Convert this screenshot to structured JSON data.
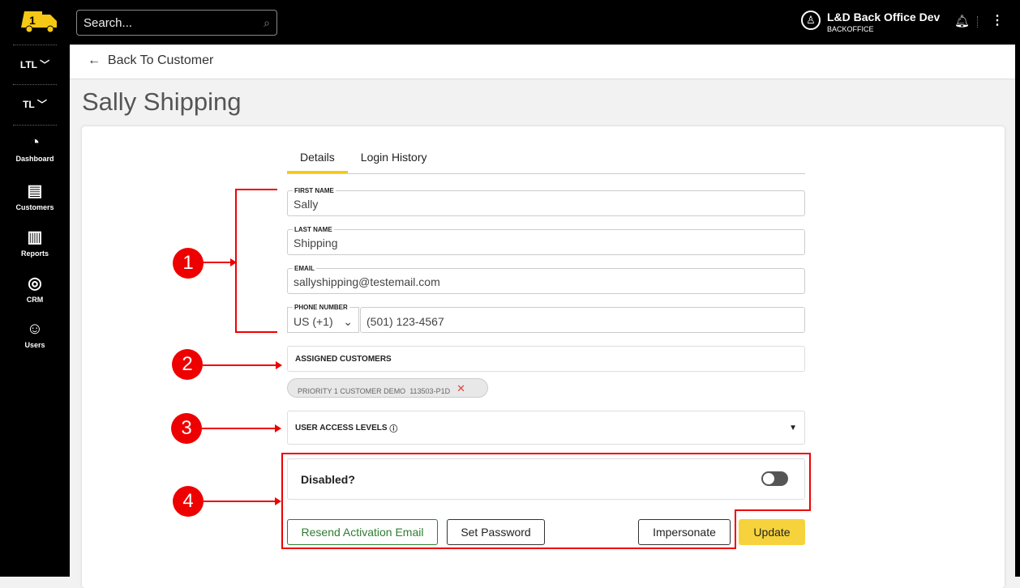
{
  "header": {
    "search_placeholder": "Search...",
    "user_name": "L&D Back Office Dev",
    "user_role": "BACKOFFICE"
  },
  "sidebar": {
    "groups": [
      {
        "label": "LTL"
      },
      {
        "label": "TL"
      }
    ],
    "items": [
      {
        "label": "Dashboard",
        "icon": "gauge-icon"
      },
      {
        "label": "Customers",
        "icon": "id-card-icon"
      },
      {
        "label": "Reports",
        "icon": "bar-chart-icon"
      },
      {
        "label": "CRM",
        "icon": "handshake-icon"
      },
      {
        "label": "Users",
        "icon": "users-icon"
      }
    ]
  },
  "back_label": "Back To Customer",
  "page_title": "Sally Shipping",
  "tabs": [
    "Details",
    "Login History"
  ],
  "form": {
    "first_name_label": "FIRST NAME",
    "first_name": "Sally",
    "last_name_label": "LAST NAME",
    "last_name": "Shipping",
    "email_label": "EMAIL",
    "email": "sallyshipping@testemail.com",
    "phone_label": "PHONE NUMBER",
    "country_code": "US (+1)",
    "phone": "(501) 123-4567",
    "assigned_label": "ASSIGNED CUSTOMERS",
    "chip_name": "PRIORITY 1 CUSTOMER DEMO",
    "chip_code": "113503-P1D",
    "access_label": "USER ACCESS LEVELS",
    "disabled_label": "Disabled?",
    "disabled": false
  },
  "buttons": {
    "resend": "Resend Activation Email",
    "set_password": "Set Password",
    "impersonate": "Impersonate",
    "update": "Update"
  },
  "annotations": [
    "1",
    "2",
    "3",
    "4"
  ],
  "colors": {
    "accent": "#f6c815",
    "annotation": "#e00000",
    "resend": "#2e7d32"
  }
}
